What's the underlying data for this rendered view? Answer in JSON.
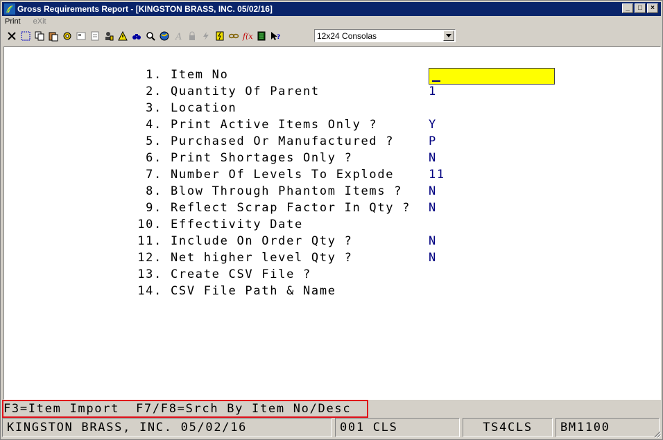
{
  "window": {
    "title": "Gross Requirements Report - [KINGSTON BRASS, INC. 05/02/16]",
    "buttons": {
      "minimize": "_",
      "maximize": "□",
      "close": "×"
    }
  },
  "menu": [
    {
      "label": "Print",
      "enabled": true
    },
    {
      "label": "eXit",
      "enabled": false
    }
  ],
  "toolbar": {
    "font_select": "12x24 Consolas"
  },
  "form": {
    "fields": [
      {
        "num": "1.",
        "label": "Item No",
        "value": ""
      },
      {
        "num": "2.",
        "label": "Quantity Of Parent",
        "value": "1"
      },
      {
        "num": "3.",
        "label": "Location",
        "value": ""
      },
      {
        "num": "4.",
        "label": "Print Active Items Only ?",
        "value": "Y"
      },
      {
        "num": "5.",
        "label": "Purchased Or Manufactured ?",
        "value": "P"
      },
      {
        "num": "6.",
        "label": "Print Shortages Only ?",
        "value": "N"
      },
      {
        "num": "7.",
        "label": "Number Of Levels To Explode",
        "value": "11"
      },
      {
        "num": "8.",
        "label": "Blow Through Phantom Items ?",
        "value": "N"
      },
      {
        "num": "9.",
        "label": "Reflect Scrap Factor In Qty ?",
        "value": "N"
      },
      {
        "num": "10.",
        "label": "Effectivity Date",
        "value": ""
      },
      {
        "num": "11.",
        "label": "Include On Order Qty ?",
        "value": "N"
      },
      {
        "num": "12.",
        "label": "Net higher level Qty ?",
        "value": "N"
      },
      {
        "num": "13.",
        "label": "Create CSV File ?",
        "value": ""
      },
      {
        "num": "14.",
        "label": "CSV File Path & Name",
        "value": ""
      }
    ]
  },
  "function_keys": "F3=Item Import  F7/F8=Srch By Item No/Desc",
  "status": {
    "company": "KINGSTON BRASS, INC. 05/02/16",
    "code": "001 CLS",
    "terminal": "TS4CLS",
    "program": "BM1100"
  },
  "colors": {
    "titlebar": "#0a246a",
    "input_highlight": "#ffff00",
    "value_text": "#000080",
    "annotation_box": "#e0101a"
  }
}
